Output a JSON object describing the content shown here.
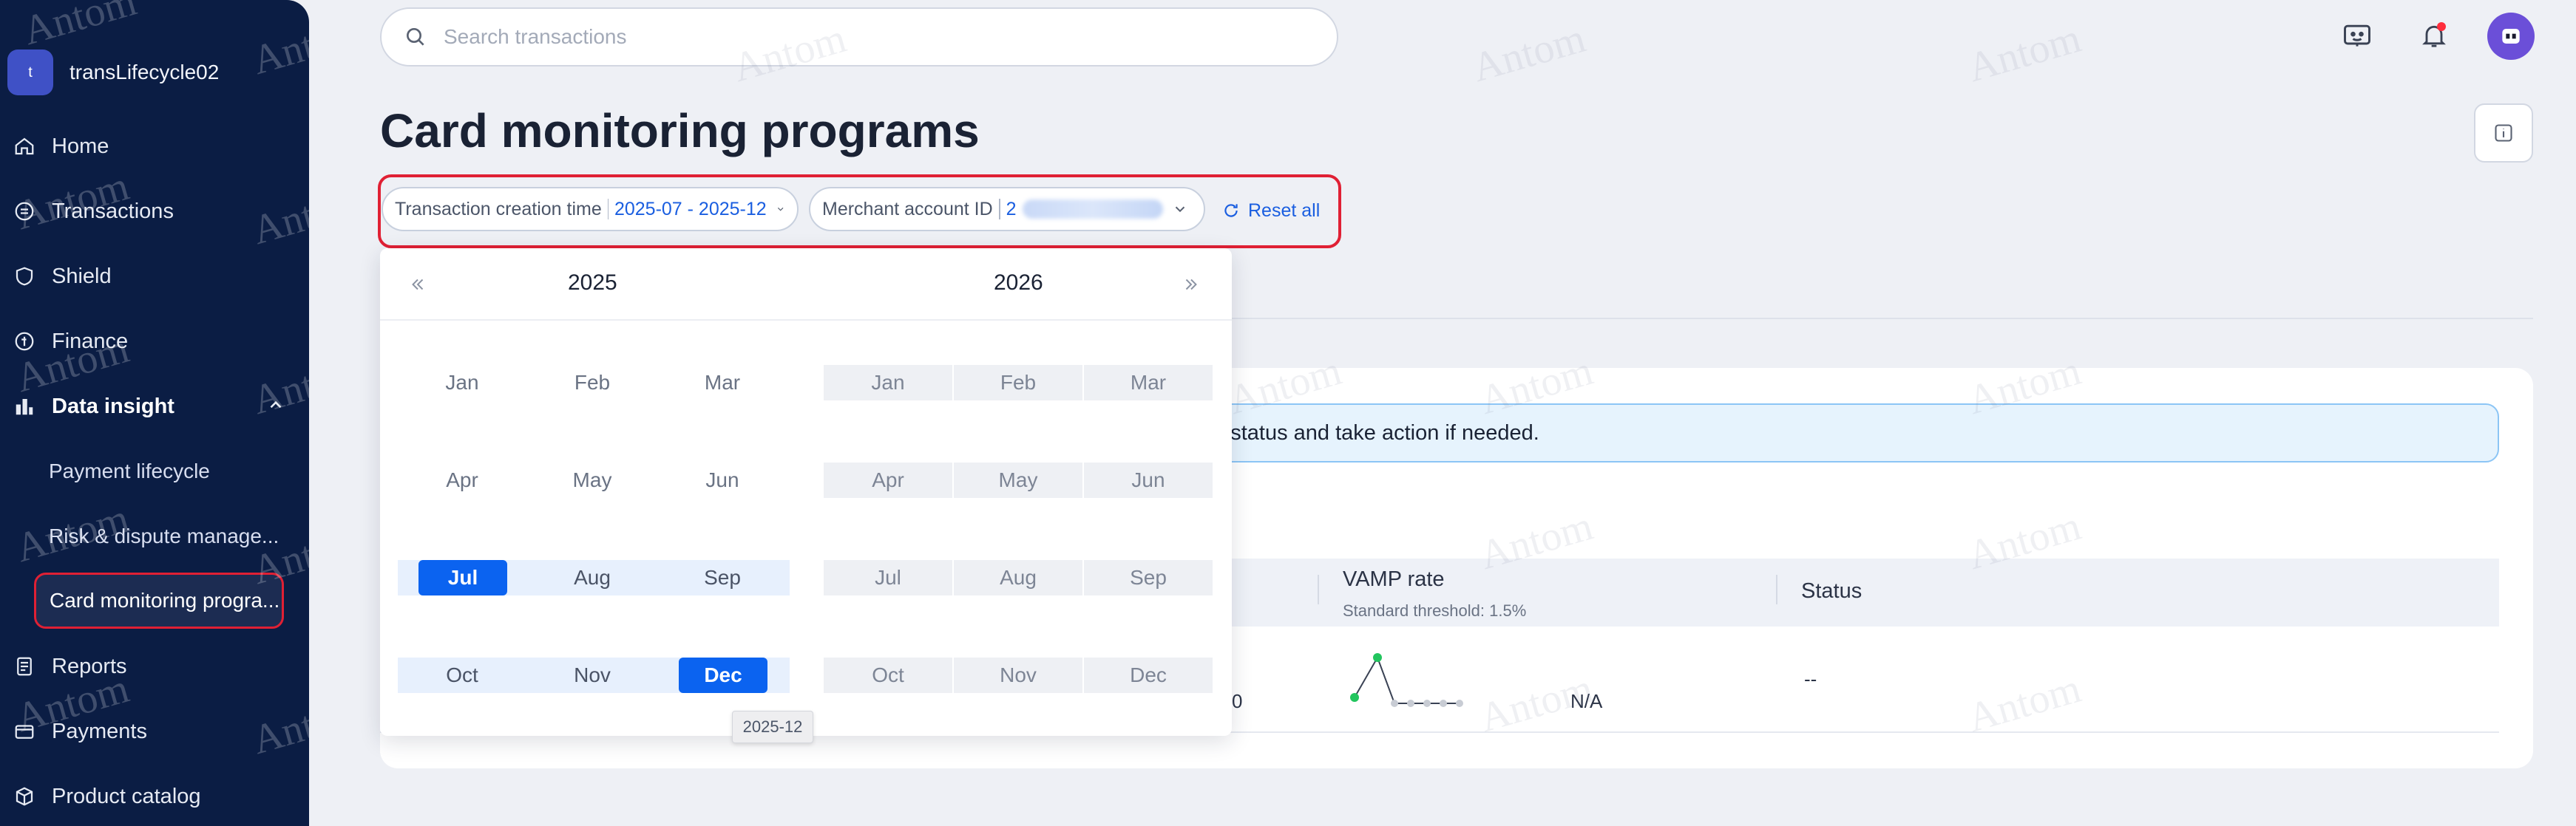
{
  "sidebar": {
    "account": {
      "initial": "t",
      "name": "transLifecycle02"
    },
    "items": [
      {
        "label": "Home",
        "icon": "home-icon"
      },
      {
        "label": "Transactions",
        "icon": "transactions-icon"
      },
      {
        "label": "Shield",
        "icon": "shield-icon"
      },
      {
        "label": "Finance",
        "icon": "finance-icon"
      },
      {
        "label": "Data insight",
        "icon": "data-insight-icon"
      },
      {
        "label": "Reports",
        "icon": "reports-icon"
      },
      {
        "label": "Payments",
        "icon": "payments-icon"
      },
      {
        "label": "Product catalog",
        "icon": "product-catalog-icon"
      }
    ],
    "data_insight_sub": [
      {
        "label": "Payment lifecycle"
      },
      {
        "label": "Risk & dispute manage..."
      },
      {
        "label": "Card monitoring progra..."
      }
    ]
  },
  "header": {
    "search_placeholder": "Search transactions",
    "icons": [
      "chatbot-icon",
      "notification-bell-icon",
      "avatar"
    ]
  },
  "page": {
    "title": "Card monitoring programs"
  },
  "filters": {
    "creation_time": {
      "label": "Transaction creation time",
      "value": "2025-07 - 2025-12"
    },
    "merchant_id": {
      "label": "Merchant account ID",
      "value": "2"
    },
    "reset_label": "Reset all"
  },
  "notice": {
    "text": "nt status and take action if needed."
  },
  "table": {
    "vamp_header": "VAMP rate",
    "vamp_sub": "Standard threshold: 1.5%",
    "status_header": "Status",
    "row": {
      "count": "0",
      "vamp_value": "N/A",
      "status": "--"
    }
  },
  "picker": {
    "left_year": "2025",
    "right_year": "2026",
    "months": [
      "Jan",
      "Feb",
      "Mar",
      "Apr",
      "May",
      "Jun",
      "Jul",
      "Aug",
      "Sep",
      "Oct",
      "Nov",
      "Dec"
    ],
    "selected_start": "Jul",
    "selected_end": "Dec",
    "tooltip": "2025-12"
  },
  "watermark": "Antom",
  "colors": {
    "accent": "#0b63f0",
    "sidebar": "#0b1d44",
    "highlight": "#e02034"
  }
}
